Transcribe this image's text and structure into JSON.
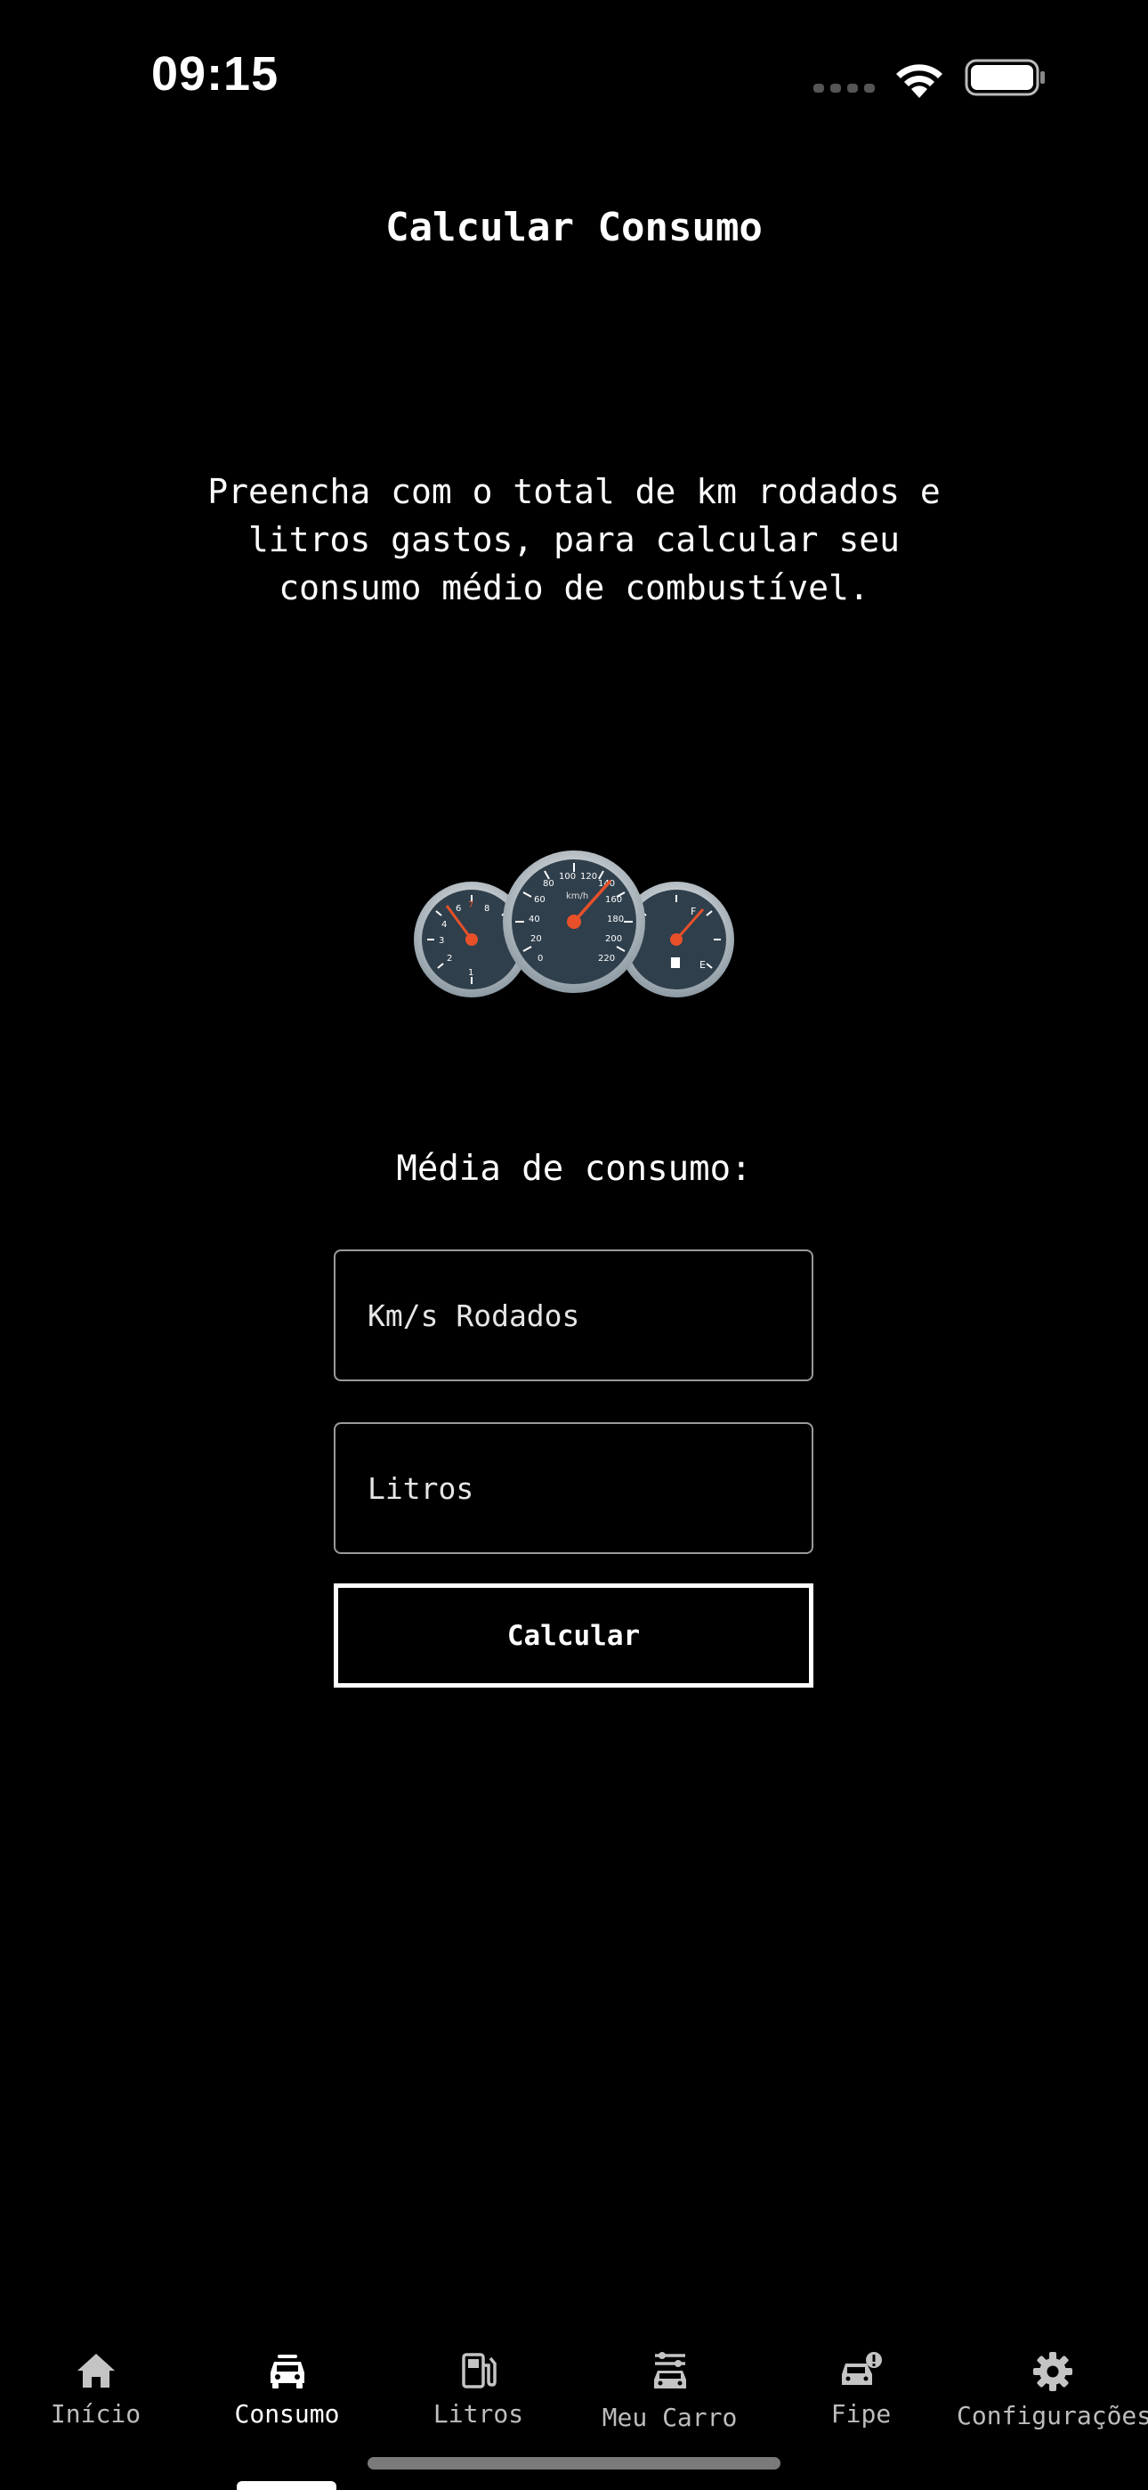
{
  "status_bar": {
    "time": "09:15"
  },
  "page": {
    "title": "Calcular Consumo",
    "description": "Preencha com o total de km rodados e\nlitros gastos, para calcular seu\nconsumo médio de combustível.",
    "section_label": "Média de consumo:"
  },
  "gauges": {
    "left_ticks": [
      "1",
      "2",
      "3",
      "4",
      "5",
      "6",
      "7",
      "8"
    ],
    "center_unit": "km/h",
    "center_ticks": [
      "0",
      "20",
      "40",
      "60",
      "80",
      "100",
      "120",
      "140",
      "160",
      "180",
      "200",
      "220"
    ],
    "right_full": "F",
    "right_empty": "E"
  },
  "form": {
    "km_placeholder": "Km/s Rodados",
    "liters_placeholder": "Litros",
    "km_value": "",
    "liters_value": "",
    "calculate_label": "Calcular"
  },
  "tabs": [
    {
      "label": "Início",
      "icon": "home-icon",
      "active": false
    },
    {
      "label": "Consumo",
      "icon": "car-icon",
      "active": true
    },
    {
      "label": "Litros",
      "icon": "fuel-pump-icon",
      "active": false
    },
    {
      "label": "Meu Carro",
      "icon": "car-settings-icon",
      "active": false
    },
    {
      "label": "Fipe",
      "icon": "car-alert-icon",
      "active": false
    },
    {
      "label": "Configurações",
      "icon": "gear-icon",
      "active": false
    }
  ],
  "colors": {
    "background": "#000000",
    "text": "#ffffff",
    "inactive_tab": "#bdbdbd",
    "gauge_face": "#2f3f4c",
    "gauge_needle": "#e8502a"
  }
}
